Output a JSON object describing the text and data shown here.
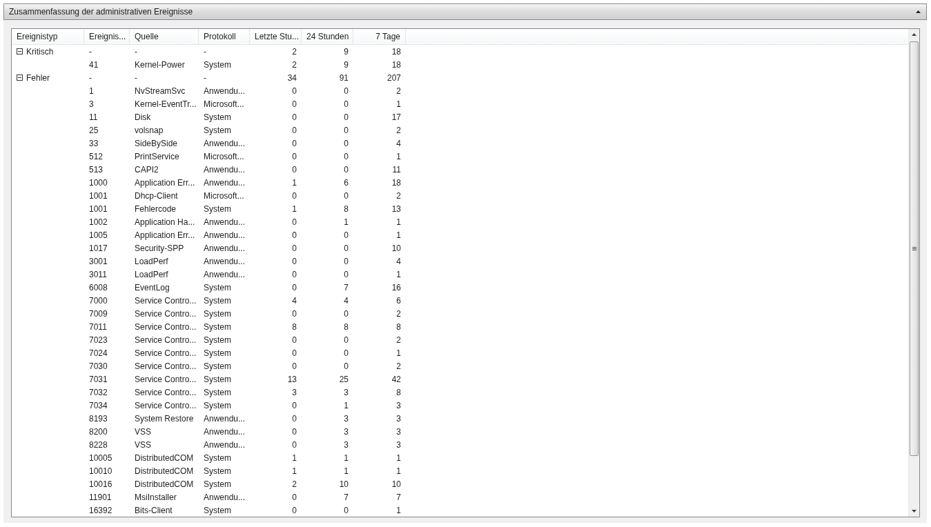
{
  "panel": {
    "title": "Zusammenfassung der administrativen Ereignisse",
    "expanded": true
  },
  "table": {
    "columns": [
      "Ereignistyp",
      "Ereignis...",
      "Quelle",
      "Protokoll",
      "Letzte Stu...",
      "24 Stunden",
      "7 Tage"
    ],
    "groups": [
      {
        "type": "Kritisch",
        "expanded": true,
        "id": "-",
        "source": "-",
        "log": "-",
        "hour": "2",
        "day": "9",
        "week": "18",
        "children": [
          {
            "id": "41",
            "source": "Kernel-Power",
            "log": "System",
            "hour": "2",
            "day": "9",
            "week": "18"
          }
        ]
      },
      {
        "type": "Fehler",
        "expanded": true,
        "id": "-",
        "source": "-",
        "log": "-",
        "hour": "34",
        "day": "91",
        "week": "207",
        "children": [
          {
            "id": "1",
            "source": "NvStreamSvc",
            "log": "Anwendu...",
            "hour": "0",
            "day": "0",
            "week": "2"
          },
          {
            "id": "3",
            "source": "Kernel-EventTr...",
            "log": "Microsoft...",
            "hour": "0",
            "day": "0",
            "week": "1"
          },
          {
            "id": "11",
            "source": "Disk",
            "log": "System",
            "hour": "0",
            "day": "0",
            "week": "17"
          },
          {
            "id": "25",
            "source": "volsnap",
            "log": "System",
            "hour": "0",
            "day": "0",
            "week": "2"
          },
          {
            "id": "33",
            "source": "SideBySide",
            "log": "Anwendu...",
            "hour": "0",
            "day": "0",
            "week": "4"
          },
          {
            "id": "512",
            "source": "PrintService",
            "log": "Microsoft...",
            "hour": "0",
            "day": "0",
            "week": "1"
          },
          {
            "id": "513",
            "source": "CAPI2",
            "log": "Anwendu...",
            "hour": "0",
            "day": "0",
            "week": "11"
          },
          {
            "id": "1000",
            "source": "Application Err...",
            "log": "Anwendu...",
            "hour": "1",
            "day": "6",
            "week": "18"
          },
          {
            "id": "1001",
            "source": "Dhcp-Client",
            "log": "Microsoft...",
            "hour": "0",
            "day": "0",
            "week": "2"
          },
          {
            "id": "1001",
            "source": "Fehlercode",
            "log": "System",
            "hour": "1",
            "day": "8",
            "week": "13"
          },
          {
            "id": "1002",
            "source": "Application Ha...",
            "log": "Anwendu...",
            "hour": "0",
            "day": "1",
            "week": "1"
          },
          {
            "id": "1005",
            "source": "Application Err...",
            "log": "Anwendu...",
            "hour": "0",
            "day": "0",
            "week": "1"
          },
          {
            "id": "1017",
            "source": "Security-SPP",
            "log": "Anwendu...",
            "hour": "0",
            "day": "0",
            "week": "10"
          },
          {
            "id": "3001",
            "source": "LoadPerf",
            "log": "Anwendu...",
            "hour": "0",
            "day": "0",
            "week": "4"
          },
          {
            "id": "3011",
            "source": "LoadPerf",
            "log": "Anwendu...",
            "hour": "0",
            "day": "0",
            "week": "1"
          },
          {
            "id": "6008",
            "source": "EventLog",
            "log": "System",
            "hour": "0",
            "day": "7",
            "week": "16"
          },
          {
            "id": "7000",
            "source": "Service Contro...",
            "log": "System",
            "hour": "4",
            "day": "4",
            "week": "6"
          },
          {
            "id": "7009",
            "source": "Service Contro...",
            "log": "System",
            "hour": "0",
            "day": "0",
            "week": "2"
          },
          {
            "id": "7011",
            "source": "Service Contro...",
            "log": "System",
            "hour": "8",
            "day": "8",
            "week": "8"
          },
          {
            "id": "7023",
            "source": "Service Contro...",
            "log": "System",
            "hour": "0",
            "day": "0",
            "week": "2"
          },
          {
            "id": "7024",
            "source": "Service Contro...",
            "log": "System",
            "hour": "0",
            "day": "0",
            "week": "1"
          },
          {
            "id": "7030",
            "source": "Service Contro...",
            "log": "System",
            "hour": "0",
            "day": "0",
            "week": "2"
          },
          {
            "id": "7031",
            "source": "Service Contro...",
            "log": "System",
            "hour": "13",
            "day": "25",
            "week": "42"
          },
          {
            "id": "7032",
            "source": "Service Contro...",
            "log": "System",
            "hour": "3",
            "day": "3",
            "week": "8"
          },
          {
            "id": "7034",
            "source": "Service Contro...",
            "log": "System",
            "hour": "0",
            "day": "1",
            "week": "3"
          },
          {
            "id": "8193",
            "source": "System Restore",
            "log": "Anwendu...",
            "hour": "0",
            "day": "3",
            "week": "3"
          },
          {
            "id": "8200",
            "source": "VSS",
            "log": "Anwendu...",
            "hour": "0",
            "day": "3",
            "week": "3"
          },
          {
            "id": "8228",
            "source": "VSS",
            "log": "Anwendu...",
            "hour": "0",
            "day": "3",
            "week": "3"
          },
          {
            "id": "10005",
            "source": "DistributedCOM",
            "log": "System",
            "hour": "1",
            "day": "1",
            "week": "1"
          },
          {
            "id": "10010",
            "source": "DistributedCOM",
            "log": "System",
            "hour": "1",
            "day": "1",
            "week": "1"
          },
          {
            "id": "10016",
            "source": "DistributedCOM",
            "log": "System",
            "hour": "2",
            "day": "10",
            "week": "10"
          },
          {
            "id": "11901",
            "source": "MsiInstaller",
            "log": "Anwendu...",
            "hour": "0",
            "day": "7",
            "week": "7"
          },
          {
            "id": "16392",
            "source": "Bits-Client",
            "log": "System",
            "hour": "0",
            "day": "0",
            "week": "1"
          }
        ]
      }
    ]
  }
}
